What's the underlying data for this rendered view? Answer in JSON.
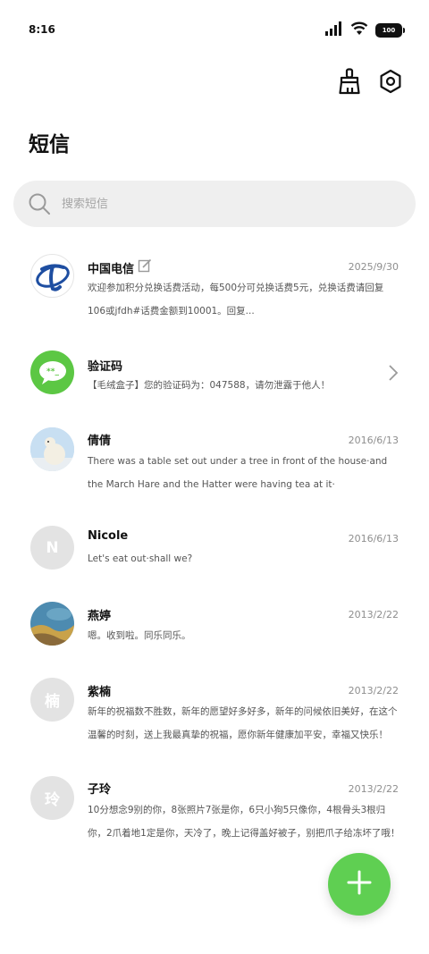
{
  "status_bar": {
    "time": "8:16",
    "battery": "100"
  },
  "header": {
    "title": "短信"
  },
  "search": {
    "placeholder": "搜索短信"
  },
  "colors": {
    "accent": "#5fcf52",
    "telecom_blue": "#1e4ea1",
    "search_bg": "#efefef"
  },
  "conversations": [
    {
      "name": "中国电信",
      "date": "2025/9/30",
      "preview": "欢迎参加积分兑换话费活动，每500分可兑换话费5元，兑换话费请回复106或jfdh#话费金额到10001。回复...",
      "avatar_icon": "china-telecom-logo",
      "badge_icon": "edit-icon"
    },
    {
      "name": "验证码",
      "date": "",
      "preview": "【毛绒盒子】您的验证码为：047588，请勿泄露于他人！",
      "avatar_icon": "chat-bubble-icon"
    },
    {
      "name": "倩倩",
      "date": "2016/6/13",
      "preview": "There was a table set out under a tree in front of the house·and the March Hare and the Hatter were having tea at it·",
      "avatar_icon": "polar-bear-photo"
    },
    {
      "name": "Nicole",
      "date": "2016/6/13",
      "preview": "Let's eat out·shall we?",
      "avatar_letter": "N"
    },
    {
      "name": "燕婷",
      "date": "2013/2/22",
      "preview": "嗯。收到啦。同乐同乐。",
      "avatar_icon": "landscape-photo"
    },
    {
      "name": "紫楠",
      "date": "2013/2/22",
      "preview": "新年的祝福数不胜数，新年的愿望好多好多，新年的问候依旧美好，在这个温馨的时刻，送上我最真挚的祝福，愿你新年健康加平安，幸福又快乐！",
      "avatar_letter": "楠"
    },
    {
      "name": "子玲",
      "date": "2013/2/22",
      "preview": "10分想念9别的你，8张照片7张是你，6只小狗5只像你，4根骨头3根归你，2爪着地1定是你，天冷了，晚上记得盖好被子，别把爪子给冻坏了哦！",
      "avatar_letter": "玲"
    }
  ]
}
